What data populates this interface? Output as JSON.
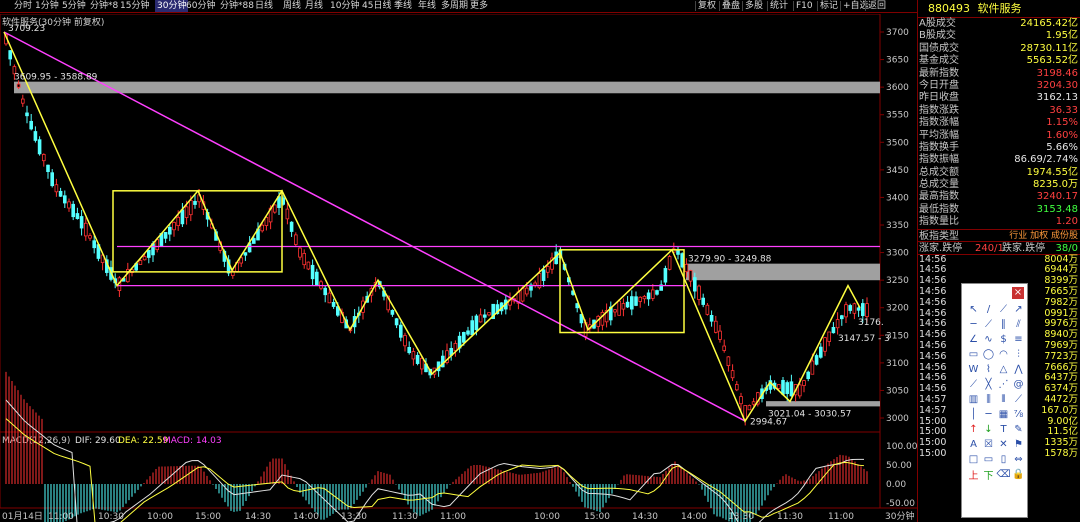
{
  "toolbar": {
    "items": [
      "分时",
      "1分钟",
      "5分钟",
      "分钟*8",
      "15分钟",
      "30分钟",
      "60分钟",
      "分钟*88",
      "日线",
      "周线",
      "月线",
      "10分钟",
      "45日线",
      "季线",
      "年线",
      "多周期",
      "更多"
    ],
    "active_index": 5,
    "right_items": [
      "复权",
      "叠盘",
      "多股",
      "统计",
      "F10",
      "标记",
      "+自选",
      "返回"
    ]
  },
  "chart_title": "软件服务(30分钟 前复权)",
  "stock": {
    "code": "880493",
    "name": "软件服务"
  },
  "stats": [
    {
      "label": "A股成交",
      "value": "24165.42亿",
      "color": "#ffff40"
    },
    {
      "label": "B股成交",
      "value": "1.95亿",
      "color": "#ffff40"
    },
    {
      "label": "国债成交",
      "value": "28730.11亿",
      "color": "#ffff40"
    },
    {
      "label": "基金成交",
      "value": "5563.52亿",
      "color": "#ffff40"
    },
    {
      "label": "最新指数",
      "value": "3198.46",
      "color": "#ff4040"
    },
    {
      "label": "今日开盘",
      "value": "3204.30",
      "color": "#ff4040"
    },
    {
      "label": "昨日收盘",
      "value": "3162.13",
      "color": "#e6e6e6"
    },
    {
      "label": "指数涨跌",
      "value": "36.33",
      "color": "#ff4040"
    },
    {
      "label": "指数涨幅",
      "value": "1.15%",
      "color": "#ff4040"
    },
    {
      "label": "平均涨幅",
      "value": "1.60%",
      "color": "#ff4040"
    },
    {
      "label": "指数换手",
      "value": "5.66%",
      "color": "#e6e6e6"
    },
    {
      "label": "指数振幅",
      "value": "86.69/2.74%",
      "color": "#e6e6e6"
    },
    {
      "label": "总成交额",
      "value": "1974.55亿",
      "color": "#ffff40"
    },
    {
      "label": "总成交量",
      "value": "8235.0万",
      "color": "#ffff40"
    },
    {
      "label": "最高指数",
      "value": "3240.17",
      "color": "#ff4040"
    },
    {
      "label": "最低指数",
      "value": "3153.48",
      "color": "#40ff40"
    },
    {
      "label": "指数量比",
      "value": "1.20",
      "color": "#ff4040"
    }
  ],
  "board": {
    "label": "板指类型",
    "links": "行业 加权 成份股"
  },
  "updown": {
    "label1": "涨家.跌停",
    "val1": "240/1",
    "label2": "跌家.跌停",
    "val2": "38/0"
  },
  "ticks": [
    {
      "time": "14:56",
      "vol": "8004万"
    },
    {
      "time": "14:56",
      "vol": "6944万"
    },
    {
      "time": "14:56",
      "vol": "8399万"
    },
    {
      "time": "14:56",
      "vol": "7665万"
    },
    {
      "time": "14:56",
      "vol": "7982万"
    },
    {
      "time": "14:56",
      "vol": "0991万"
    },
    {
      "time": "14:56",
      "vol": "9976万"
    },
    {
      "time": "14:56",
      "vol": "8940万"
    },
    {
      "time": "14:56",
      "vol": "7969万"
    },
    {
      "time": "14:56",
      "vol": "7723万"
    },
    {
      "time": "14:56",
      "vol": "7666万"
    },
    {
      "time": "14:56",
      "vol": "6437万"
    },
    {
      "time": "14:56",
      "vol": "6374万"
    },
    {
      "time": "14:57",
      "vol": "4472万"
    },
    {
      "time": "14:57",
      "vol": "167.0万"
    },
    {
      "time": "15:00",
      "vol": "9.00亿"
    },
    {
      "time": "15:00",
      "vol": "11.5亿"
    },
    {
      "time": "15:00",
      "vol": "1335万"
    },
    {
      "time": "15:00",
      "vol": "1578万"
    }
  ],
  "price_axis": {
    "ticks": [
      "3700",
      "3650",
      "3600",
      "3550",
      "3500",
      "3450",
      "3400",
      "3350",
      "3300",
      "3250",
      "3200",
      "3150",
      "3100",
      "3050",
      "3000"
    ]
  },
  "macd": {
    "label": "MACD(12,26,9)",
    "dif_label": "DIF: 29.60",
    "dea_label": "DEA: 22.59",
    "macd_label": "MACD: 14.03",
    "axis_ticks": [
      "100.00",
      "50.00",
      "0.00",
      "-50.00"
    ],
    "period_label": "30分钟"
  },
  "time_axis": [
    "01月14日",
    "11:00",
    "10:30",
    "10:00",
    "15:00",
    "14:30",
    "14:00",
    "13:30",
    "11:30",
    "11:00",
    "10:00",
    "15:00",
    "14:30",
    "14:00",
    "13:30",
    "11:30",
    "11:00"
  ],
  "annotations": {
    "high": "3709.23",
    "zone1": "3609.95 - 3588.89",
    "zone2": "3279.90 - 3249.88",
    "zone3": "3021.04 - 3030.57",
    "low": "2994.67",
    "last_val": "3176.",
    "right_zone": "3147.57 - 3"
  },
  "palette": {
    "close_label": "×"
  },
  "colors": {
    "up": "#ff3232",
    "down": "#54ffff",
    "yellow_line": "#ffff40",
    "magenta_line": "#ff40ff",
    "band": "#a0a0a0"
  }
}
